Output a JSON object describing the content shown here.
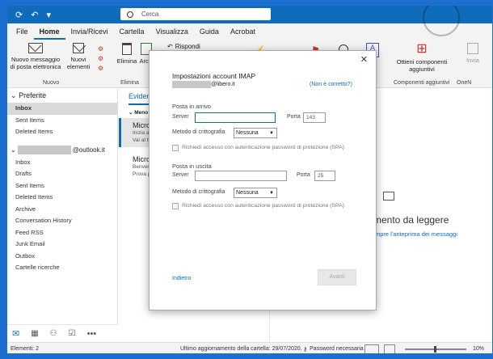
{
  "titlebar": {
    "search_placeholder": "Cerca"
  },
  "menu": [
    "File",
    "Home",
    "Invia/Ricevi",
    "Cartella",
    "Visualizza",
    "Guida",
    "Acrobat"
  ],
  "ribbon": {
    "new_message": "Nuovo messaggio di posta elettronica",
    "new_items": "Nuovi elementi",
    "group_new": "Nuovo",
    "delete": "Elimina",
    "archive": "Archi",
    "group_delete": "Elimina",
    "reply": "Rispondi",
    "new_addins": "Ottieni componenti aggiuntivi",
    "group_addins": "Componenti aggiuntivi",
    "onenote_1": "Invia",
    "onenote_2": "OneN"
  },
  "folders": {
    "favorites_title": "Preferite",
    "favorites": [
      "Inbox",
      "Sent Items",
      "Deleted Items"
    ],
    "account_suffix": "@outlook.it",
    "account_items": [
      "Inbox",
      "Drafts",
      "Sent Items",
      "Deleted Items",
      "Archive",
      "Conversation History",
      "Feed RSS",
      "Junk Email",
      "Outbox",
      "Cartelle ricerche"
    ]
  },
  "message_list": {
    "tab": "Evidenz",
    "group": "Meno re",
    "items": [
      {
        "from": "Micros",
        "line1": "Inizia a",
        "line2": "Vai al tu"
      },
      {
        "from": "Micros",
        "line1": "Benvenu",
        "line2": "Prova pe"
      }
    ]
  },
  "reading": {
    "title": "mento da leggere",
    "link": "mpre l'anteprima dei messaggi"
  },
  "dialog": {
    "title": "Impostazioni account IMAP",
    "email_suffix": "@libero.it",
    "not_correct": "(Non è corretto?)",
    "incoming_title": "Posta in arrivo",
    "server_label": "Server",
    "port_label": "Porta",
    "incoming_port": "143",
    "encryption_label": "Metodo di crittografia",
    "encryption_value": "Nessuna",
    "spa_label": "Richiedi accesso con autenticazione password di protezione (SPA)",
    "outgoing_title": "Posta in uscita",
    "outgoing_port": "25",
    "back": "Indietro",
    "next": "Avanti"
  },
  "status": {
    "items": "Elementi: 2",
    "updated": "Ultimo aggiornamento della cartella: 29/07/2020.",
    "password": "Password necessaria",
    "zoom": "10%"
  },
  "colors": {
    "accent": "#0f6cbd",
    "desktop": "#1a6fd1"
  }
}
